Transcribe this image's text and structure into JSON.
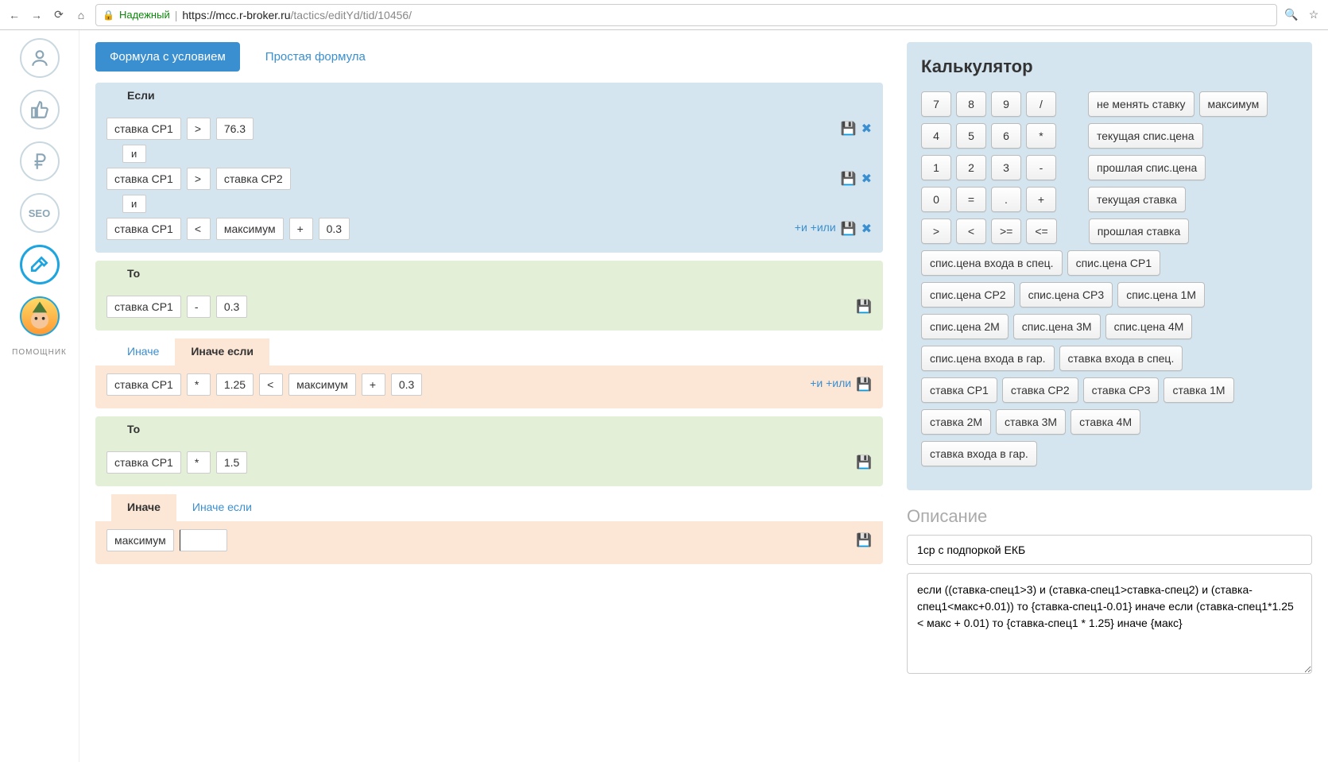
{
  "browser": {
    "secure_label": "Надежный",
    "url_base": "https://mcc.r-broker.ru",
    "url_path": "/tactics/editYd/tid/10456/"
  },
  "sidebar": {
    "seo_label": "SEO",
    "helper_label": "ПОМОЩНИК"
  },
  "top_tabs": {
    "conditional": "Формула с условием",
    "simple": "Простая формула"
  },
  "if_block": {
    "label": "Если",
    "row1": [
      "ставка СР1",
      ">",
      "76.3"
    ],
    "conn1": "и",
    "row2": [
      "ставка СР1",
      ">",
      "ставка СР2"
    ],
    "conn2": "и",
    "row3": [
      "ставка СР1",
      "<",
      "максимум",
      "+",
      "0.3"
    ],
    "add_and_or": "+и +или"
  },
  "then_block": {
    "label": "То",
    "row1": [
      "ставка СР1",
      "-",
      "0.3"
    ]
  },
  "elseif_block": {
    "tab_inache": "Иначе",
    "tab_inache_esli": "Иначе если",
    "row1": [
      "ставка СР1",
      "*",
      "1.25",
      "<",
      "максимум",
      "+",
      "0.3"
    ],
    "add_and_or": "+и +или"
  },
  "then2_block": {
    "label": "То",
    "row1": [
      "ставка СР1",
      "*",
      "1.5"
    ]
  },
  "else_block": {
    "tab_inache": "Иначе",
    "tab_inache_esli": "Иначе если",
    "row1": [
      "максимум"
    ]
  },
  "calculator": {
    "title": "Калькулятор",
    "keypad": [
      [
        "7",
        "8",
        "9",
        "/"
      ],
      [
        "4",
        "5",
        "6",
        "*"
      ],
      [
        "1",
        "2",
        "3",
        "-"
      ],
      [
        "0",
        "=",
        ".",
        "+"
      ],
      [
        ">",
        "<",
        ">=",
        "<="
      ]
    ],
    "right_buttons": [
      [
        "не менять ставку",
        "максимум"
      ],
      [
        "текущая спис.цена"
      ],
      [
        "прошлая спис.цена"
      ],
      [
        "текущая ставка"
      ],
      [
        "прошлая ставка"
      ]
    ],
    "bottom_buttons": [
      [
        "спис.цена входа в спец.",
        "спис.цена СР1"
      ],
      [
        "спис.цена СР2",
        "спис.цена СР3",
        "спис.цена 1М"
      ],
      [
        "спис.цена 2М",
        "спис.цена 3М",
        "спис.цена 4М"
      ],
      [
        "спис.цена входа в гар.",
        "ставка входа в спец."
      ],
      [
        "ставка СР1",
        "ставка СР2",
        "ставка СР3",
        "ставка 1М"
      ],
      [
        "ставка 2М",
        "ставка 3М",
        "ставка 4М"
      ],
      [
        "ставка входа в гар."
      ]
    ]
  },
  "description": {
    "label": "Описание",
    "input_value": "1ср с подпоркой ЕКБ",
    "text_value": "если ((ставка-спец1>3) и (ставка-спец1>ставка-спец2) и (ставка-спец1<макс+0.01)) то {ставка-спец1-0.01} иначе если (ставка-спец1*1.25 < макс + 0.01) то {ставка-спец1 * 1.25} иначе {макс}"
  }
}
